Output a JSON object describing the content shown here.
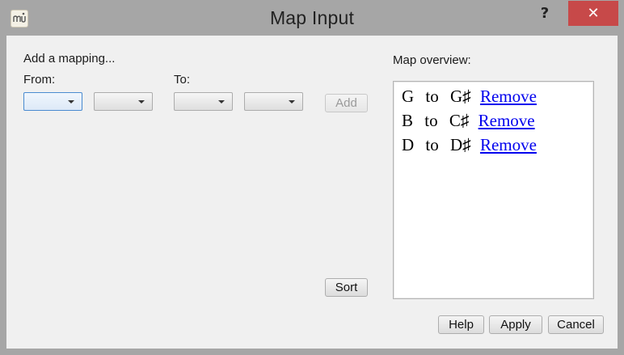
{
  "window": {
    "title": "Map Input",
    "help_glyph": "?",
    "close_glyph": "✕"
  },
  "add_section": {
    "heading": "Add a mapping...",
    "from_label": "From:",
    "to_label": "To:",
    "from_note_value": "",
    "from_accidental_value": "",
    "to_note_value": "",
    "to_accidental_value": "",
    "add_label": "Add",
    "sort_label": "Sort"
  },
  "overview": {
    "heading": "Map overview:",
    "mappings": [
      {
        "from": "G",
        "connector": "to",
        "to": "G♯",
        "remove_label": "Remove"
      },
      {
        "from": "B",
        "connector": "to",
        "to": "C♯",
        "remove_label": "Remove"
      },
      {
        "from": "D",
        "connector": "to",
        "to": "D♯",
        "remove_label": "Remove"
      }
    ]
  },
  "footer": {
    "help_label": "Help",
    "apply_label": "Apply",
    "cancel_label": "Cancel"
  },
  "colors": {
    "close_button": "#c74949",
    "link": "#0000ee",
    "focus_border": "#4a8bd0"
  }
}
